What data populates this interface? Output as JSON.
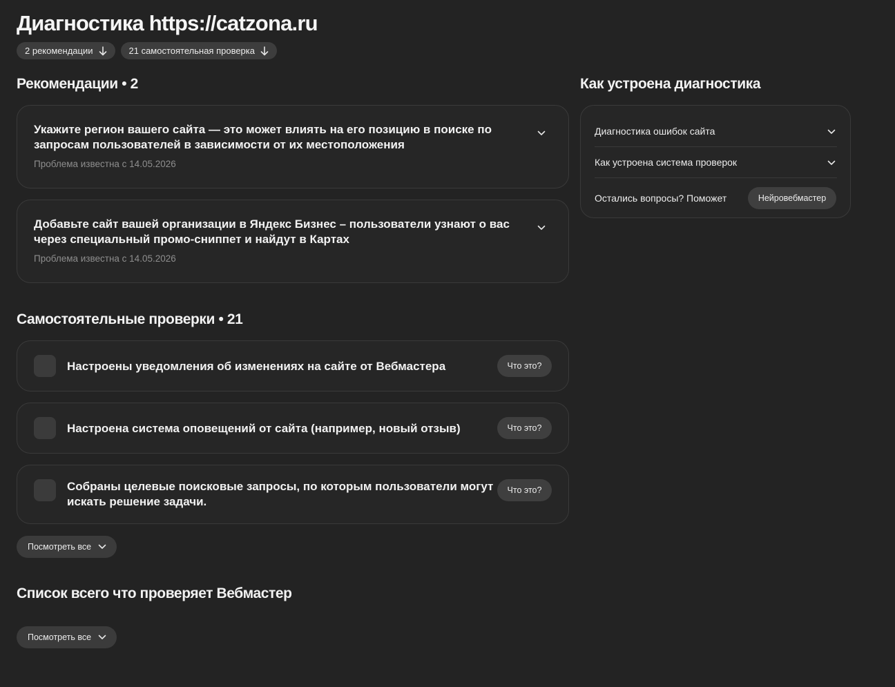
{
  "page": {
    "title": "Диагностика https://catzona.ru"
  },
  "chips": [
    {
      "label": "2 рекомендации"
    },
    {
      "label": "21 самостоятельная проверка"
    }
  ],
  "recommendations": {
    "title": "Рекомендации • 2",
    "items": [
      {
        "title": "Укажите регион вашего сайта — это может влиять на его позицию в поиске по запросам пользователей в зависимости от их местоположения",
        "subtitle": "Проблема известна с 14.05.2026"
      },
      {
        "title": "Добавьте сайт вашей организации в Яндекс Бизнес – пользователи узнают о вас через специальный промо-сниппет и найдут в Картах",
        "subtitle": "Проблема известна с 14.05.2026"
      }
    ]
  },
  "self_checks": {
    "title": "Самостоятельные проверки • 21",
    "items": [
      {
        "text": "Настроены уведомления об изменениях на сайте от Вебмастера",
        "button": "Что это?"
      },
      {
        "text": "Настроена система оповещений от сайта (например, новый отзыв)",
        "button": "Что это?"
      },
      {
        "text": "Собраны целевые поисковые запросы, по которым пользователи могут искать решение задачи.",
        "button": "Что это?"
      }
    ],
    "see_all": "Посмотреть все"
  },
  "checklist": {
    "title": "Список всего что проверяет Вебмастер",
    "see_all": "Посмотреть все"
  },
  "sidebar": {
    "title": "Как устроена диагностика",
    "rows": [
      {
        "label": "Диагностика ошибок сайта"
      },
      {
        "label": "Как устроена система проверок"
      }
    ],
    "question": "Остались вопросы? Поможет",
    "button": "Нейровебмастер"
  },
  "colors": {
    "background": "#232323",
    "card": "#262626",
    "border": "#3a3a3a",
    "muted_text": "#8e8e8e"
  }
}
